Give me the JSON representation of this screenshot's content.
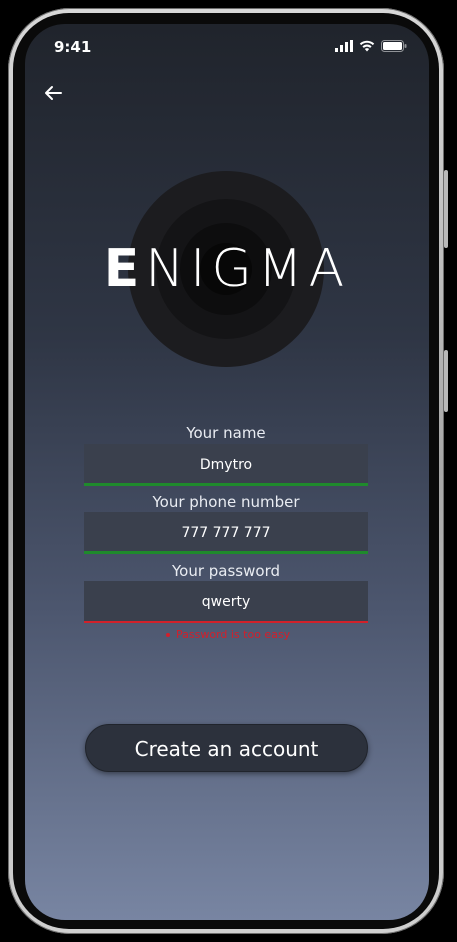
{
  "status_bar": {
    "time": "9:41"
  },
  "logo": {
    "first_letter": "E",
    "rest": "NIGMA"
  },
  "form": {
    "name_label": "Your name",
    "name_value": "Dmytro",
    "phone_label": "Your phone number",
    "phone_value": "777 777 777",
    "password_label": "Your password",
    "password_value": "qwerty",
    "password_error": "Password is too easy"
  },
  "create_button_label": "Create an account",
  "colors": {
    "valid_underline": "#1f8a2c",
    "error": "#d31f2b",
    "button_bg": "#2c313c"
  },
  "icons": {
    "back": "left-arrow-icon",
    "signal": "signal-icon",
    "wifi": "wifi-icon",
    "battery": "battery-icon"
  }
}
